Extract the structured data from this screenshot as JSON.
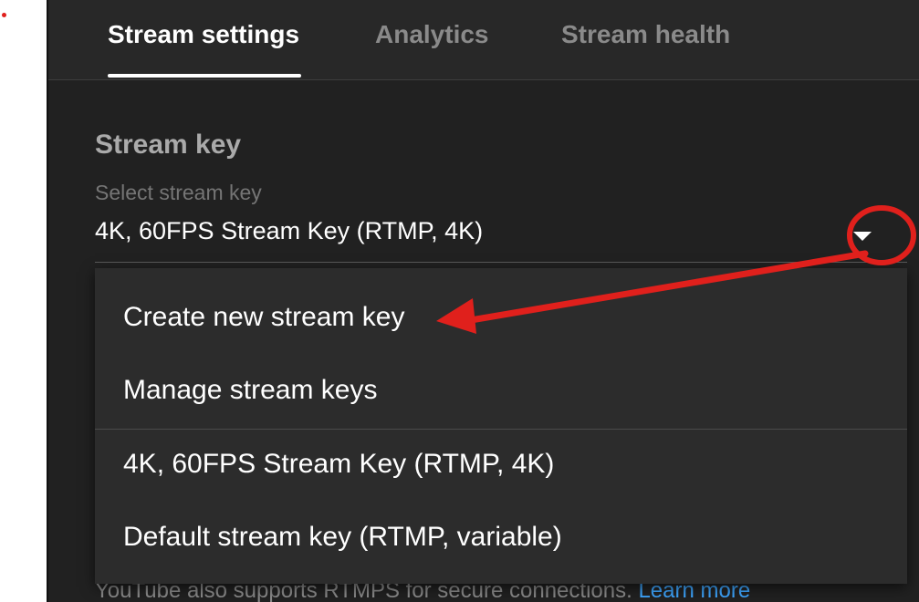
{
  "tabs": [
    {
      "label": "Stream settings",
      "active": true
    },
    {
      "label": "Analytics",
      "active": false
    },
    {
      "label": "Stream health",
      "active": false
    }
  ],
  "stream_key": {
    "section_title": "Stream key",
    "select_label": "Select stream key",
    "selected_value": "4K, 60FPS Stream Key (RTMP, 4K)",
    "dropdown_icon": "caret-down-icon"
  },
  "menu": {
    "actions": [
      "Create new stream key",
      "Manage stream keys"
    ],
    "keys": [
      "4K, 60FPS Stream Key (RTMP, 4K)",
      "Default stream key (RTMP, variable)"
    ]
  },
  "footer": {
    "text": "YouTube also supports RTMPS for secure connections.",
    "link": "Learn more"
  },
  "colors": {
    "panel_bg": "#212121",
    "menu_bg": "#2c2c2c",
    "link": "#3ea6ff",
    "annotation": "#e0201c"
  }
}
